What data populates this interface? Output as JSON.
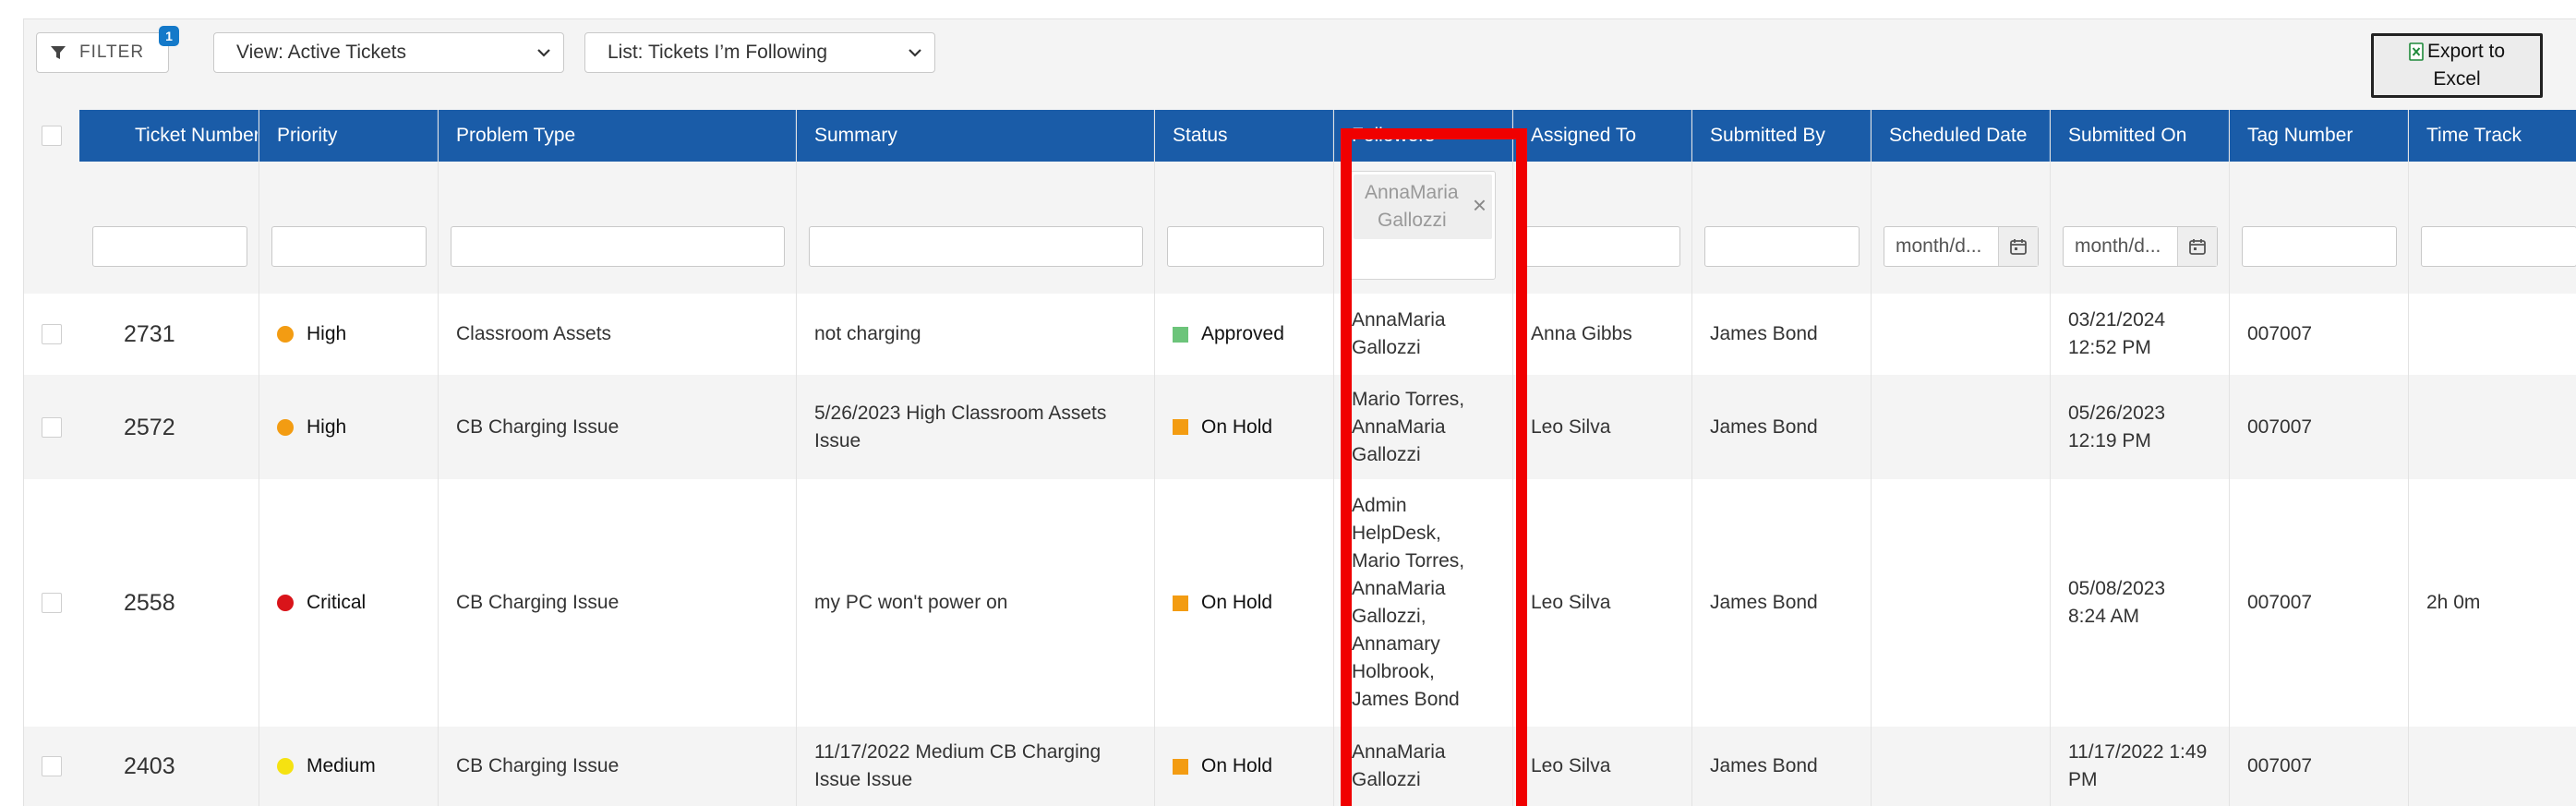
{
  "toolbar": {
    "filter_label": "FILTER",
    "filter_badge": "1",
    "view_select": "View: Active Tickets",
    "list_select": "List: Tickets I’m Following",
    "export_line1": "Export to",
    "export_line2": "Excel"
  },
  "columns": [
    "Ticket Number",
    "Priority",
    "Problem Type",
    "Summary",
    "Status",
    "Followers",
    "Assigned To",
    "Submitted By",
    "Scheduled Date",
    "Submitted On",
    "Tag Number",
    "Time Track"
  ],
  "filters": {
    "followers_chip_line1": "AnnaMaria",
    "followers_chip_line2": "Gallozzi",
    "date_placeholder": "month/d..."
  },
  "rows": [
    {
      "ticket": "2731",
      "priority": "High",
      "priority_color": "#f39c12",
      "problem": "Classroom Assets",
      "summary": [
        "not charging"
      ],
      "status": "Approved",
      "status_color": "#6cc47a",
      "followers": [
        "AnnaMaria",
        "Gallozzi"
      ],
      "assigned": "Anna Gibbs",
      "submitted_by": "James Bond",
      "scheduled": "",
      "submitted_on": [
        "03/21/2024",
        "12:52 PM"
      ],
      "tag": "007007",
      "time": ""
    },
    {
      "ticket": "2572",
      "priority": "High",
      "priority_color": "#f39c12",
      "problem": "CB Charging Issue",
      "summary": [
        "5/26/2023 High Classroom Assets",
        "Issue"
      ],
      "status": "On Hold",
      "status_color": "#f39c12",
      "followers": [
        "Mario Torres,",
        "AnnaMaria",
        "Gallozzi"
      ],
      "assigned": "Leo Silva",
      "submitted_by": "James Bond",
      "scheduled": "",
      "submitted_on": [
        "05/26/2023",
        "12:19 PM"
      ],
      "tag": "007007",
      "time": ""
    },
    {
      "ticket": "2558",
      "priority": "Critical",
      "priority_color": "#d9141a",
      "problem": "CB Charging Issue",
      "summary": [
        "my PC won't power on"
      ],
      "status": "On Hold",
      "status_color": "#f39c12",
      "followers": [
        "Admin",
        "HelpDesk,",
        "Mario Torres,",
        "AnnaMaria",
        "Gallozzi,",
        "Annamary",
        "Holbrook,",
        "James Bond"
      ],
      "assigned": "Leo Silva",
      "submitted_by": "James Bond",
      "scheduled": "",
      "submitted_on": [
        "05/08/2023",
        "8:24 AM"
      ],
      "tag": "007007",
      "time": "2h 0m"
    },
    {
      "ticket": "2403",
      "priority": "Medium",
      "priority_color": "#f5e211",
      "problem": "CB Charging Issue",
      "summary": [
        "11/17/2022 Medium CB Charging",
        "Issue Issue"
      ],
      "status": "On Hold",
      "status_color": "#f39c12",
      "followers": [
        "AnnaMaria",
        "Gallozzi"
      ],
      "assigned": "Leo Silva",
      "submitted_by": "James Bond",
      "scheduled": "",
      "submitted_on": [
        "11/17/2022 1:49",
        "PM"
      ],
      "tag": "007007",
      "time": ""
    }
  ],
  "colors": {
    "header_bg": "#1a5ca8",
    "highlight": "#f00000",
    "badge": "#1479c9"
  }
}
